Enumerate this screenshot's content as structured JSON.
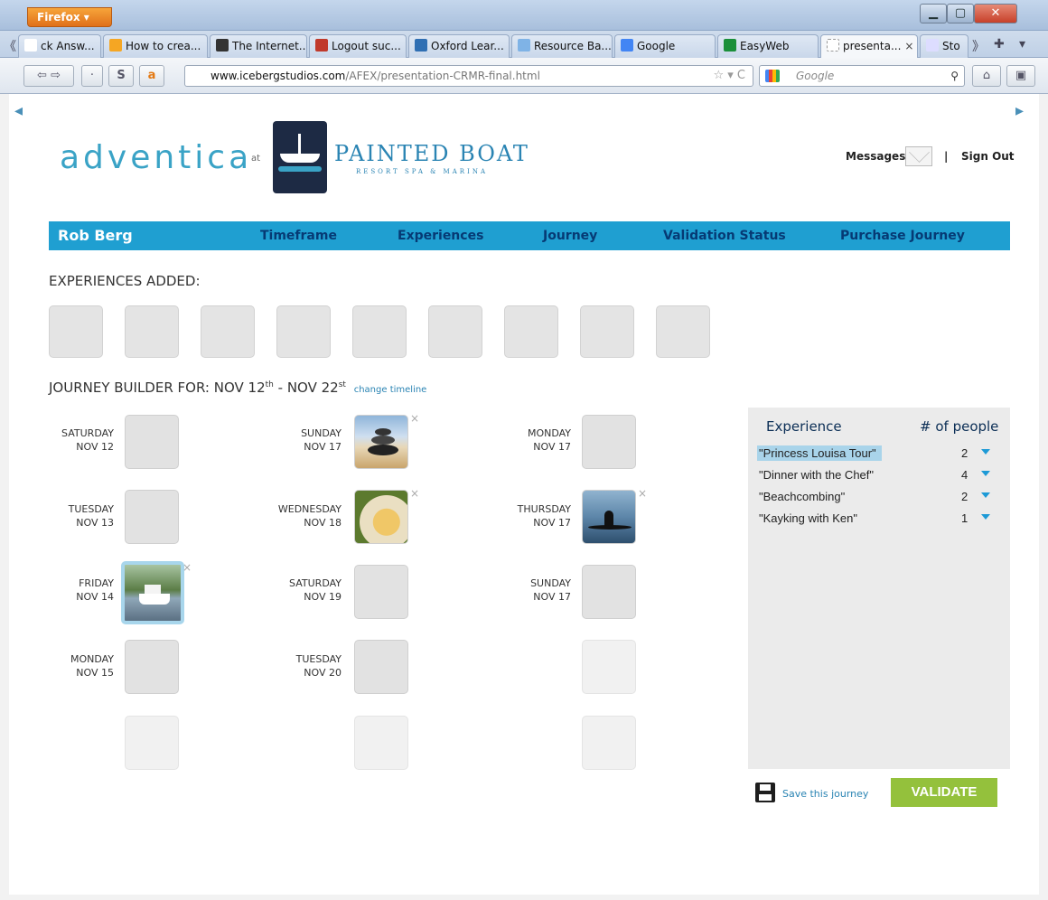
{
  "browser": {
    "firefox_label": "Firefox ▾",
    "tab_nav_left": "《",
    "tab_nav_right": "》",
    "tab_new": "✚",
    "tab_list": "▾",
    "tabs": [
      {
        "label": "ck Answ...",
        "color": "#ffffff"
      },
      {
        "label": "How to crea...",
        "color": "#f5a623"
      },
      {
        "label": "The Internet...",
        "color": "#333333"
      },
      {
        "label": "Logout suc...",
        "color": "#c0392b"
      },
      {
        "label": "Oxford Lear...",
        "color": "#2f6fb3"
      },
      {
        "label": "Resource Ba...",
        "color": "#7fb3e6"
      },
      {
        "label": "Google",
        "color": "#4285f4"
      },
      {
        "label": "EasyWeb",
        "color": "#1a8f3a"
      },
      {
        "label": "presenta...",
        "color": "#ffffff"
      },
      {
        "label": "Sto",
        "color": "#ddddff"
      }
    ],
    "tab_close": "×",
    "url_domain": "www.icebergstudios.com",
    "url_path": "/AFEX/presentation-CRMR-final.html",
    "url_icons": "☆ ▾ C",
    "search_placeholder": "Google",
    "search_icon": "⚲",
    "back": "⇦",
    "forward": "⇨",
    "dropdown": "·",
    "s_btn": "S",
    "a_btn": "a",
    "home": "⌂",
    "addon": "▣",
    "min": "▁",
    "max": "▢",
    "close": "✕"
  },
  "brand": {
    "name": "adventica",
    "at": "at",
    "resort": "PAINTED BOAT",
    "resort_sub": "RESORT SPA & MARINA"
  },
  "header": {
    "messages": "Messages",
    "sep": "|",
    "sign_out": "Sign Out"
  },
  "menu": {
    "user": "Rob Berg",
    "items": [
      "Timeframe",
      "Experiences",
      "Journey",
      "Validation Status",
      "Purchase Journey"
    ]
  },
  "experiences_added": {
    "title": "EXPERIENCES ADDED:",
    "slot_count": 9
  },
  "journey": {
    "title_prefix": "JOURNEY BUILDER FOR: NOV 12",
    "sup1": "th",
    "mid": " - NOV 22",
    "sup2": "st",
    "change": "change timeline",
    "remove": "×",
    "days": [
      {
        "day": "SATURDAY",
        "date": "NOV 12"
      },
      {
        "day": "SUNDAY",
        "date": "NOV 17"
      },
      {
        "day": "MONDAY",
        "date": "NOV 17"
      },
      {
        "day": "TUESDAY",
        "date": "NOV 13"
      },
      {
        "day": "WEDNESDAY",
        "date": "NOV 18"
      },
      {
        "day": "THURSDAY",
        "date": "NOV 17"
      },
      {
        "day": "FRIDAY",
        "date": "NOV 14"
      },
      {
        "day": "SATURDAY",
        "date": "NOV 19"
      },
      {
        "day": "SUNDAY",
        "date": "NOV 17"
      },
      {
        "day": "MONDAY",
        "date": "NOV 15"
      },
      {
        "day": "TUESDAY",
        "date": "NOV 20"
      }
    ]
  },
  "panel": {
    "col_experience": "Experience",
    "col_people": "# of people",
    "rows": [
      {
        "name": "\"Princess Louisa Tour\"",
        "count": "2"
      },
      {
        "name": "\"Dinner with the Chef\"",
        "count": "4"
      },
      {
        "name": "\"Beachcombing\"",
        "count": "2"
      },
      {
        "name": "\"Kayking with Ken\"",
        "count": "1"
      }
    ]
  },
  "footer": {
    "save": "Save this journey",
    "validate": "VALIDATE"
  },
  "colors": {
    "menu_bg": "#1f9fd1",
    "menu_text": "#063a74",
    "validate_bg": "#94c13c",
    "accent": "#2a84b3"
  }
}
